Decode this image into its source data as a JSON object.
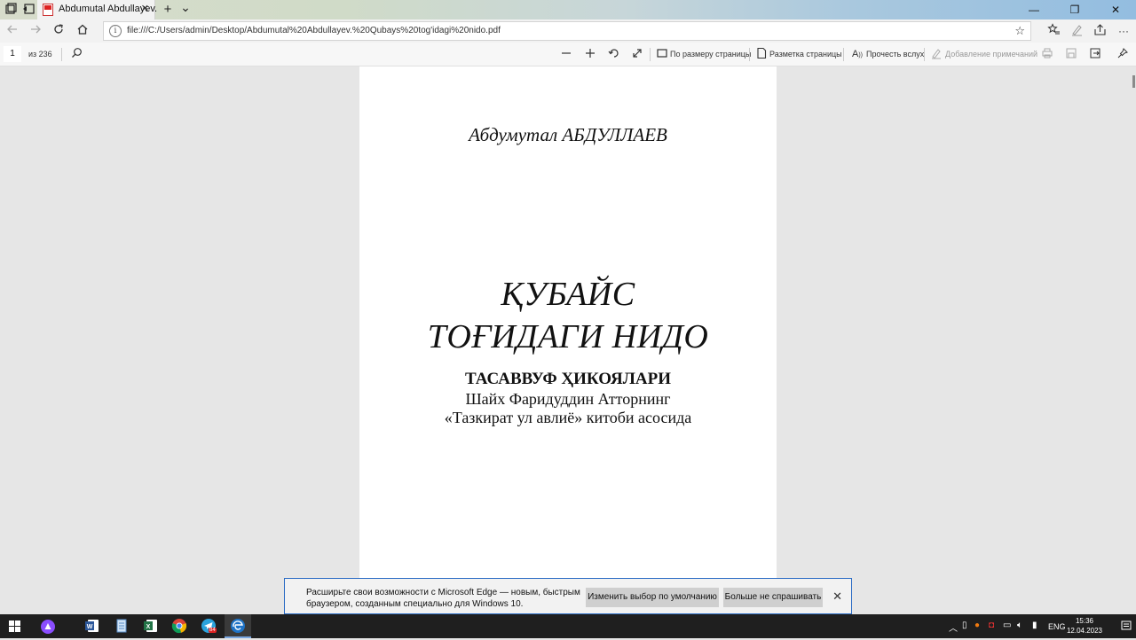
{
  "browser": {
    "tab_title": "Abdumutal Abdullayev.",
    "tab_close": "✕",
    "new_tab": "+",
    "tab_menu": "⌄",
    "minimize": "—",
    "restore": "❐",
    "close": "✕",
    "url": "file:///C:/Users/admin/Desktop/Abdumutal%20Abdullayev.%20Qubays%20tog'idagi%20nido.pdf",
    "info_glyph": "i",
    "more": "···"
  },
  "pdf_toolbar": {
    "current_page": "1",
    "page_count": "из 236",
    "fit_page_label": "По размеру страницы",
    "page_layout_label": "Разметка страницы",
    "read_aloud_label": "Прочесть вслух",
    "add_notes_label": "Добавление примечаний"
  },
  "document": {
    "author": "Абдумутал АБДУЛЛАЕВ",
    "title_line1": "ҚУБАЙС",
    "title_line2": "ТОҒИДАГИ НИДО",
    "subtitle": "ТАСАВВУФ ҲИКОЯЛАРИ",
    "line2": "Шайх Фаридуддин Атторнинг",
    "line3": "«Тазкират ул авлиё» китоби асосида"
  },
  "notification": {
    "message": "Расширьте свои возможности с Microsoft Edge — новым, быстрым браузером, созданным специально для Windows 10.",
    "default_button": "Изменить выбор по умолчанию",
    "dismiss_button": "Больше не спрашивать",
    "close_glyph": "✕"
  },
  "taskbar": {
    "language": "ENG",
    "time": "15:36",
    "date": "12.04.2023",
    "telegram_badge": "84"
  },
  "colors": {
    "accent": "#2b6cc4",
    "taskbar": "#1f1f1f"
  }
}
